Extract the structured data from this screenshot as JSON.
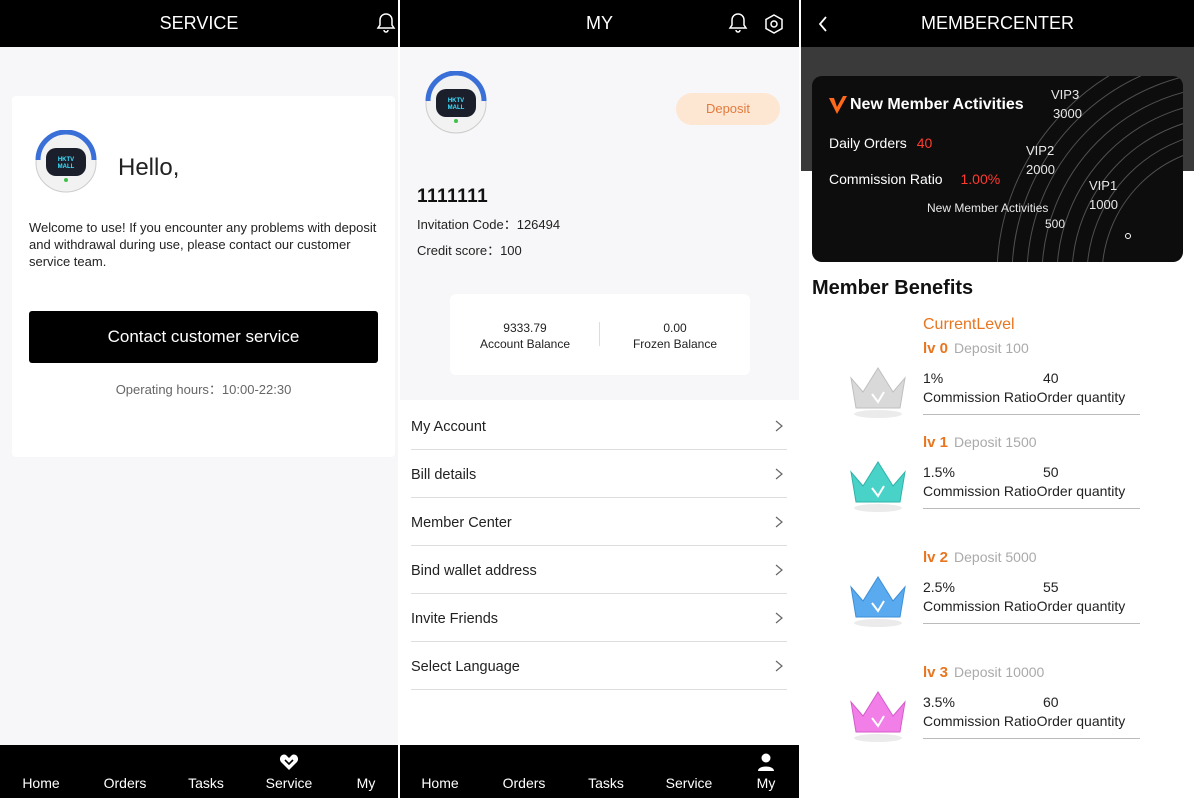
{
  "service": {
    "title": "SERVICE",
    "hello": "Hello,",
    "welcome": "Welcome to use! If you encounter any problems with deposit and withdrawal during use, please contact our customer service team.",
    "contact_button": "Contact customer service",
    "hours": "Operating hours：10:00-22:30",
    "tabs": [
      "Home",
      "Orders",
      "Tasks",
      "Service",
      "My"
    ],
    "active_tab": "Service"
  },
  "my": {
    "title": "MY",
    "deposit_button": "Deposit",
    "username": "1111111",
    "invitation": "Invitation Code：126494",
    "credit": "Credit score：100",
    "account_balance_value": "9333.79",
    "account_balance_label": "Account Balance",
    "frozen_balance_value": "0.00",
    "frozen_balance_label": "Frozen Balance",
    "menu": [
      "My Account",
      "Bill details",
      "Member Center",
      "Bind wallet address",
      "Invite Friends",
      "Select Language"
    ],
    "tabs": [
      "Home",
      "Orders",
      "Tasks",
      "Service",
      "My"
    ],
    "active_tab": "My"
  },
  "member": {
    "title": "MEMBERCENTER",
    "card": {
      "title": "New Member Activities",
      "daily_orders_label": "Daily Orders",
      "daily_orders_value": "40",
      "commission_label": "Commission Ratio",
      "commission_value": "1.00%",
      "vip3": "VIP3",
      "vip3_val": "3000",
      "vip2": "VIP2",
      "vip2_val": "2000",
      "vip1": "VIP1",
      "vip1_val": "1000",
      "new_label": "New Member Activities",
      "new_val": "500"
    },
    "benefits_title": "Member Benefits",
    "current_level": "CurrentLevel",
    "levels": [
      {
        "tag": "lv 0",
        "deposit": "Deposit 100",
        "ratio": "1%",
        "orders": "40",
        "ratio_label": "Commission Ratio",
        "orders_label": "Order quantity",
        "color": "#d9d9d9"
      },
      {
        "tag": "lv 1",
        "deposit": "Deposit 1500",
        "ratio": "1.5%",
        "orders": "50",
        "ratio_label": "Commission Ratio",
        "orders_label": "Order quantity",
        "color": "#49d3c8"
      },
      {
        "tag": "lv 2",
        "deposit": "Deposit 5000",
        "ratio": "2.5%",
        "orders": "55",
        "ratio_label": "Commission Ratio",
        "orders_label": "Order quantity",
        "color": "#5aaaf0"
      },
      {
        "tag": "lv 3",
        "deposit": "Deposit 10000",
        "ratio": "3.5%",
        "orders": "60",
        "ratio_label": "Commission Ratio",
        "orders_label": "Order quantity",
        "color": "#f27ee8"
      }
    ]
  },
  "logo_text": "HKTV MALL",
  "colors": {
    "accent": "#e8751f",
    "red": "#ff3b2f",
    "deposit_bg": "#fde6d2"
  }
}
